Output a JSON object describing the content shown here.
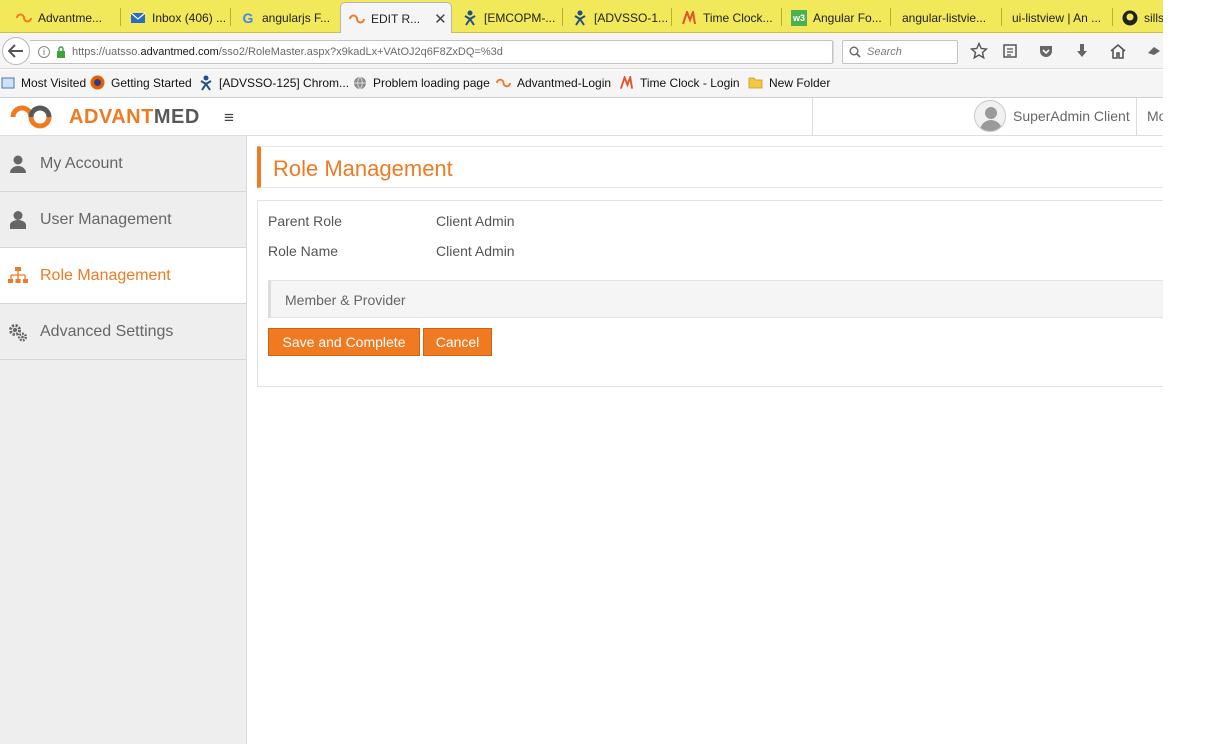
{
  "browser": {
    "tabs": [
      {
        "label": "Advantme...",
        "icon": "advantmed-icon"
      },
      {
        "label": "Inbox (406) ...",
        "icon": "mail-icon"
      },
      {
        "label": "angularjs F...",
        "icon": "google-icon"
      },
      {
        "label": "EDIT R...",
        "icon": "advantmed-icon",
        "active": true
      },
      {
        "label": "[EMCOPM-...",
        "icon": "jira-icon"
      },
      {
        "label": "[ADVSSO-1...",
        "icon": "jira-icon"
      },
      {
        "label": "Time Clock...",
        "icon": "timeclock-icon"
      },
      {
        "label": "Angular Fo...",
        "icon": "w3-icon"
      },
      {
        "label": "angular-listvie...",
        "icon": ""
      },
      {
        "label": "ui-listview | An ...",
        "icon": ""
      },
      {
        "label": "sills",
        "icon": "github-icon"
      }
    ],
    "url": {
      "prefix": "https://uatsso.",
      "host": "advantmed.com",
      "path": "/sso2/RoleMaster.aspx?x9kadLx+VAtOJ2q6F8ZxDQ=%3d"
    },
    "search_placeholder": "Search",
    "bookmarks": [
      {
        "label": "Most Visited",
        "icon": "page-icon"
      },
      {
        "label": "Getting Started",
        "icon": "firefox-icon"
      },
      {
        "label": "[ADVSSO-125] Chrom...",
        "icon": "jira-icon"
      },
      {
        "label": "Problem loading page",
        "icon": "globe-icon"
      },
      {
        "label": "Advantmed-Login",
        "icon": "advantmed-icon"
      },
      {
        "label": "Time Clock - Login",
        "icon": "timeclock-icon"
      },
      {
        "label": "New Folder",
        "icon": "folder-icon"
      }
    ]
  },
  "app": {
    "logo": {
      "accent": "ADVANT",
      "rest": "MED"
    },
    "user": "SuperAdmin Client",
    "more": "Mo",
    "sidebar": [
      {
        "label": "My Account",
        "icon": "user-icon"
      },
      {
        "label": "User Management",
        "icon": "users-icon"
      },
      {
        "label": "Role Management",
        "icon": "hierarchy-icon",
        "active": true
      },
      {
        "label": "Advanced Settings",
        "icon": "gears-icon"
      }
    ],
    "page_title": "Role Management",
    "fields": [
      {
        "label": "Parent Role",
        "value": "Client Admin"
      },
      {
        "label": "Role Name",
        "value": "Client Admin"
      }
    ],
    "section": "Member & Provider",
    "buttons": {
      "save": "Save and Complete",
      "cancel": "Cancel"
    }
  },
  "colors": {
    "accent": "#f07a22",
    "tabbar": "#f1e95a",
    "sidebar": "#eeeeee"
  }
}
